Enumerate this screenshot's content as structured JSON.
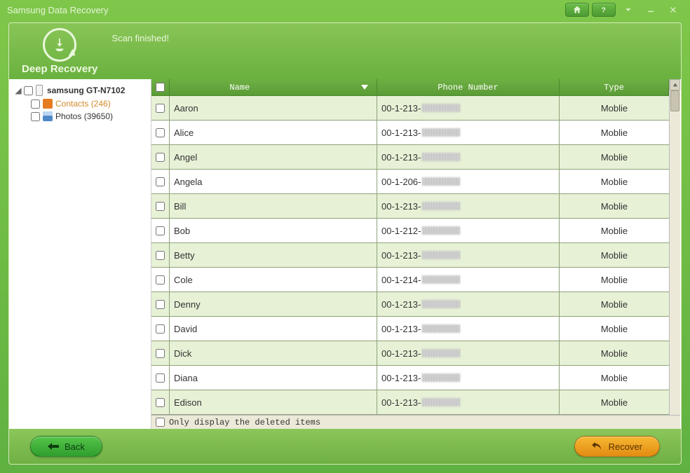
{
  "window": {
    "title": "Samsung Data Recovery"
  },
  "status": "Scan finished!",
  "deep_recovery_label": "Deep Recovery",
  "tree": {
    "device": "samsung GT-N7102",
    "contacts_label": "Contacts (246)",
    "photos_label": "Photos (39650)"
  },
  "columns": {
    "name": "Name",
    "phone": "Phone Number",
    "type": "Type"
  },
  "rows": [
    {
      "name": "Aaron",
      "phone": "00-1-213-",
      "type": "Moblie"
    },
    {
      "name": "Alice",
      "phone": "00-1-213-",
      "type": "Moblie"
    },
    {
      "name": "Angel",
      "phone": "00-1-213-",
      "type": "Moblie"
    },
    {
      "name": "Angela",
      "phone": "00-1-206-",
      "type": "Moblie"
    },
    {
      "name": "Bill",
      "phone": "00-1-213-",
      "type": "Moblie"
    },
    {
      "name": "Bob",
      "phone": "00-1-212-",
      "type": "Moblie"
    },
    {
      "name": "Betty",
      "phone": "00-1-213-",
      "type": "Moblie"
    },
    {
      "name": "Cole",
      "phone": "00-1-214-",
      "type": "Moblie"
    },
    {
      "name": "Denny",
      "phone": "00-1-213-",
      "type": "Moblie"
    },
    {
      "name": "David",
      "phone": "00-1-213-",
      "type": "Moblie"
    },
    {
      "name": "Dick",
      "phone": "00-1-213-",
      "type": "Moblie"
    },
    {
      "name": "Diana",
      "phone": "00-1-213-",
      "type": "Moblie"
    },
    {
      "name": "Edison",
      "phone": "00-1-213-",
      "type": "Moblie"
    }
  ],
  "filter_label": "Only display the deleted items",
  "buttons": {
    "back": "Back",
    "recover": "Recover"
  }
}
